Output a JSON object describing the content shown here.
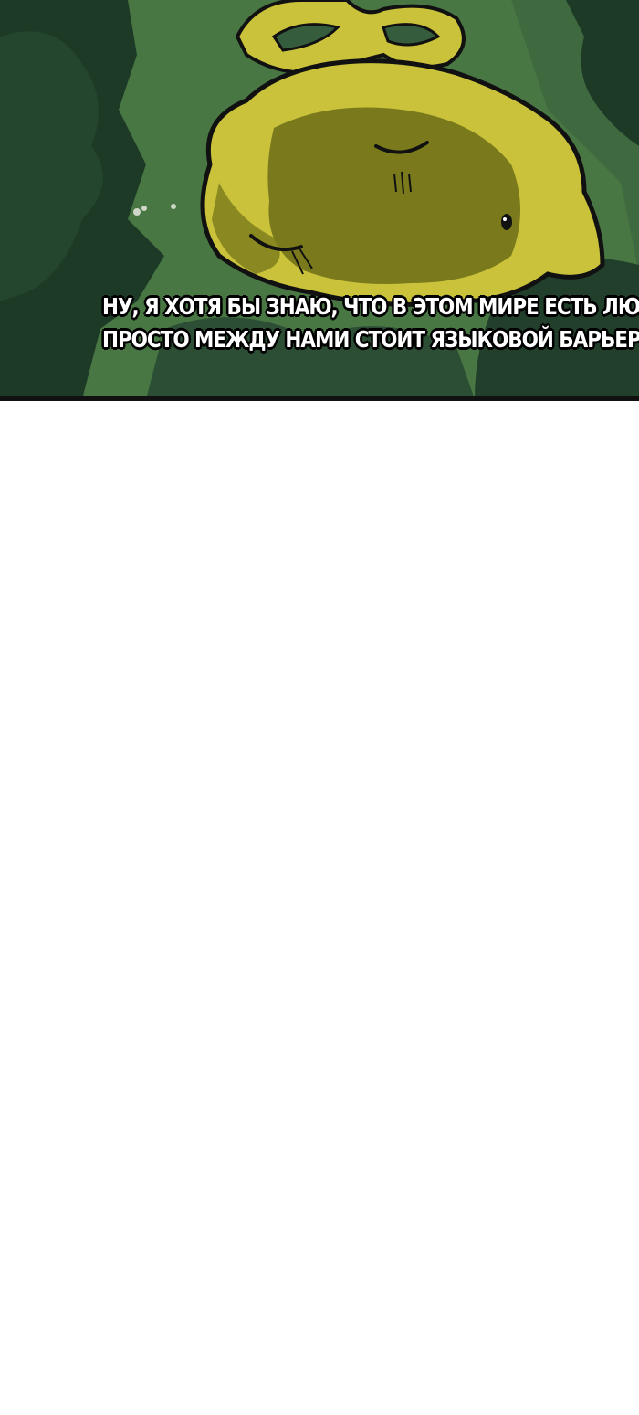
{
  "panel": {
    "caption_lines": [
      "НУ, Я ХОТЯ БЫ ЗНАЮ, ЧТО В ЭТОМ МИРЕ ЕСТЬ ЛЮДИ,",
      "ПРОСТО МЕЖДУ НАМИ СТОИТ ЯЗЫКОВОЙ БАРЬЕР."
    ]
  },
  "colors": {
    "forest_dark": "#1f3a28",
    "forest_mid": "#355c3c",
    "grass": "#4d7a45",
    "slime_light": "#c9c23a",
    "slime_shadow": "#7a7a1c",
    "outline": "#111111"
  }
}
